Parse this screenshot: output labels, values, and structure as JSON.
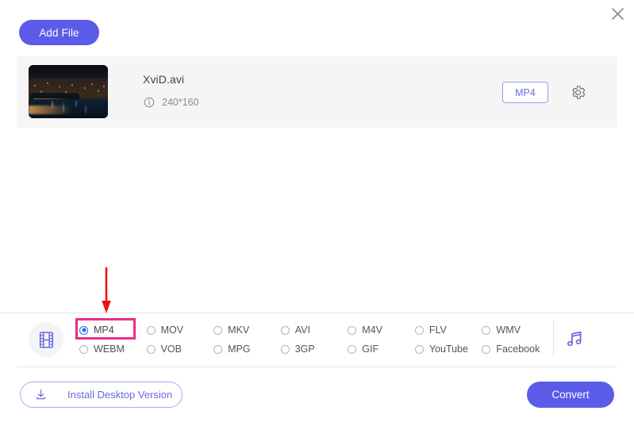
{
  "window": {
    "close_label": "×"
  },
  "toolbar": {
    "add_file_label": "Add File"
  },
  "file_row": {
    "name": "XviD.avi",
    "resolution": "240*160",
    "info_icon": "info-icon",
    "format_badge": "MP4",
    "settings_icon": "gear-icon",
    "thumbnail_alt": "night-cityscape-thumbnail"
  },
  "format_bar": {
    "video_icon": "film-strip-icon",
    "audio_icon": "music-note-icon",
    "selected": "MP4",
    "options": [
      {
        "label": "MP4",
        "selected": true
      },
      {
        "label": "MOV",
        "selected": false
      },
      {
        "label": "MKV",
        "selected": false
      },
      {
        "label": "AVI",
        "selected": false
      },
      {
        "label": "M4V",
        "selected": false
      },
      {
        "label": "FLV",
        "selected": false
      },
      {
        "label": "WMV",
        "selected": false
      },
      {
        "label": "WEBM",
        "selected": false
      },
      {
        "label": "VOB",
        "selected": false
      },
      {
        "label": "MPG",
        "selected": false
      },
      {
        "label": "3GP",
        "selected": false
      },
      {
        "label": "GIF",
        "selected": false
      },
      {
        "label": "YouTube",
        "selected": false
      },
      {
        "label": "Facebook",
        "selected": false
      }
    ]
  },
  "footer": {
    "install_label": "Install Desktop Version",
    "install_icon": "download-icon",
    "convert_label": "Convert"
  },
  "annotations": {
    "arrow_color": "#ee1111",
    "highlight_color": "#ec2b8a",
    "arrow_target": "MP4",
    "highlight_target": "MP4"
  },
  "colors": {
    "accent": "#5b5bea",
    "accent_outline": "#6b6bdd",
    "radio_selected": "#1a73e8",
    "row_background": "#f5f5f6",
    "separator": "#e3e3e5"
  }
}
